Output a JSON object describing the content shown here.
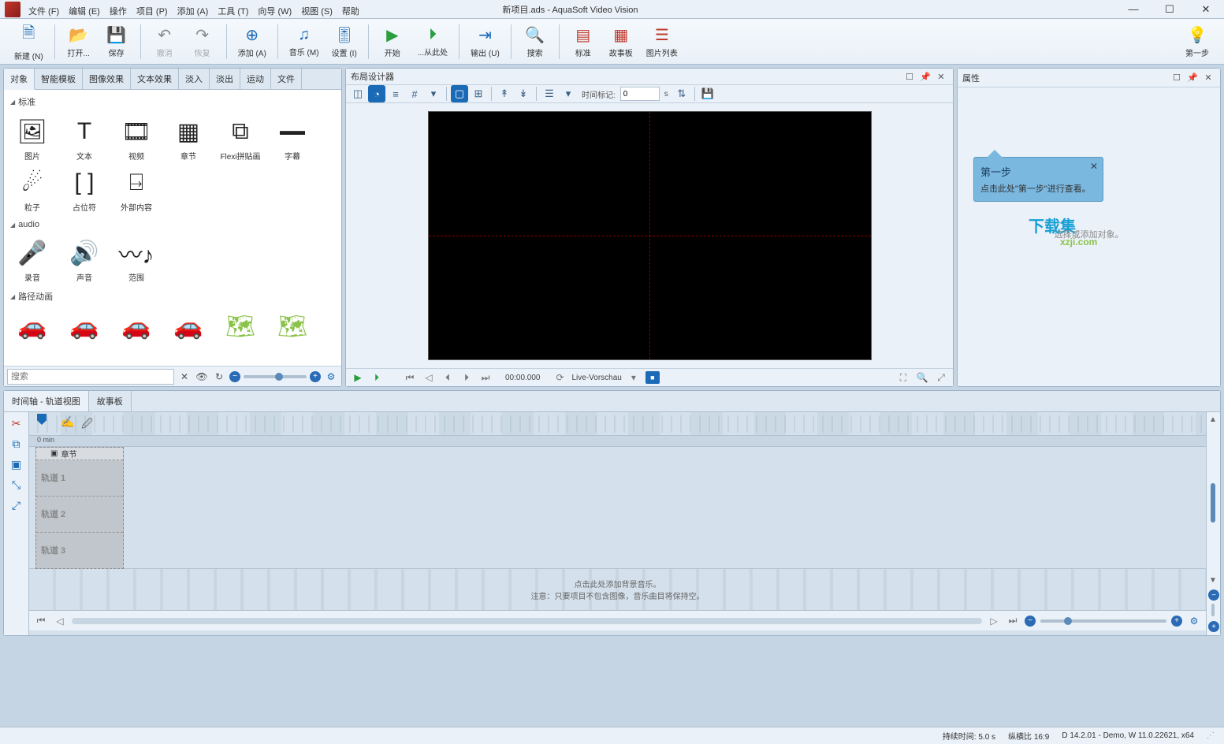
{
  "app": {
    "title": "新项目.ads - AquaSoft Video Vision",
    "min": "—",
    "max": "☐",
    "close": "✕"
  },
  "menu": [
    "文件 (F)",
    "编辑 (E)",
    "操作",
    "项目 (P)",
    "添加 (A)",
    "工具 (T)",
    "向导 (W)",
    "视图 (S)",
    "帮助"
  ],
  "toolbar": {
    "new": "新建 (N)",
    "open": "打开...",
    "save": "保存",
    "undo": "撤消",
    "redo": "恢复",
    "add": "添加 (A)",
    "music": "音乐 (M)",
    "settings": "设置 (I)",
    "start": "开始",
    "fromhere": "...从此处",
    "output": "输出 (U)",
    "search": "搜索",
    "standard": "标准",
    "storyboard": "故事板",
    "imagelist": "图片列表",
    "nextstep": "第一步"
  },
  "objects": {
    "tabs": [
      "对象",
      "智能模板",
      "图像效果",
      "文本效果",
      "淡入",
      "淡出",
      "运动",
      "文件"
    ],
    "sec_standard": "标准",
    "items_standard": [
      {
        "label": "图片"
      },
      {
        "label": "文本"
      },
      {
        "label": "视频"
      },
      {
        "label": "章节"
      },
      {
        "label": "Flexi拼贴画"
      },
      {
        "label": "字幕"
      },
      {
        "label": "粒子"
      },
      {
        "label": "占位符"
      },
      {
        "label": "外部内容"
      }
    ],
    "sec_audio": "audio",
    "items_audio": [
      {
        "label": "录音"
      },
      {
        "label": "声音"
      },
      {
        "label": "范围"
      }
    ],
    "sec_path": "路径动画",
    "search_placeholder": "搜索"
  },
  "designer": {
    "title": "布局设计器",
    "time_label": "时间标记:",
    "time_value": "0",
    "time_unit": "s",
    "playback_time": "00:00.000",
    "preview": "Live-Vorschau"
  },
  "properties": {
    "title": "属性",
    "bubble_title": "第一步",
    "bubble_text": "点击此处\"第一步\"进行查看。",
    "hint": "选择或添加对象。",
    "watermark1": "下载集",
    "watermark2": "xzji.com"
  },
  "timeline": {
    "tabs": [
      "时间轴 - 轨道视图",
      "故事板"
    ],
    "ruler_zero": "0 min",
    "chapter": "章节",
    "tracks": [
      "轨道 1",
      "轨道 2",
      "轨道 3"
    ],
    "music_hint1": "点击此处添加背景音乐。",
    "music_hint2": "注意：只要项目不包含图像，音乐曲目将保持空。"
  },
  "status": {
    "duration_label": "持续时间:",
    "duration_value": "5.0 s",
    "aspect_label": "纵横比",
    "aspect_value": "16:9",
    "version": "D 14.2.01 - Demo, W 11.0.22621, x64"
  }
}
